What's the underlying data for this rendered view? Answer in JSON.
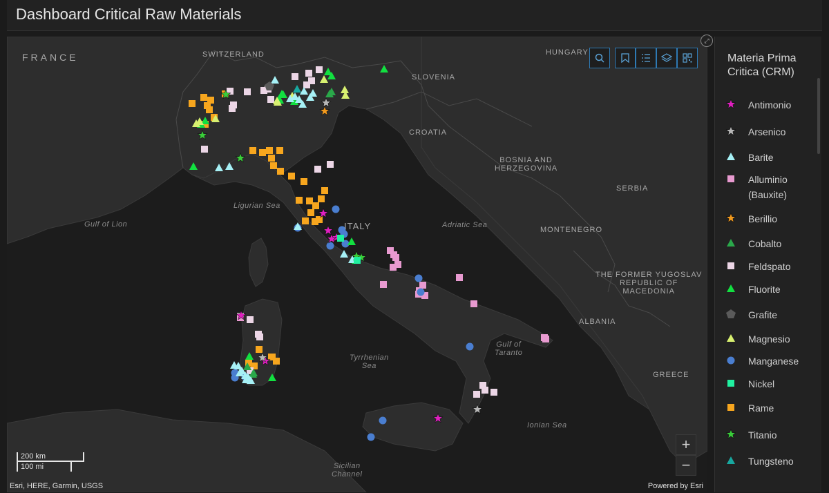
{
  "header": {
    "title": "Dashboard Critical Raw Materials"
  },
  "map": {
    "labels": {
      "france": "FRANCE",
      "switzerland": "SWITZERLAND",
      "hungary": "HUNGARY",
      "slovenia": "SLOVENIA",
      "croatia": "CROATIA",
      "bosnia": "BOSNIA AND\nHERZEGOVINA",
      "serbia": "SERBIA",
      "montenegro": "MONTENEGRO",
      "fyrom": "THE FORMER YUGOSLAV\nREPUBLIC OF\nMACEDONIA",
      "albania": "ALBANIA",
      "greece": "GREECE",
      "italy": "ITALY",
      "ligurian": "Ligurian Sea",
      "lion": "Gulf of Lion",
      "adriatic": "Adriatic Sea",
      "taranto": "Gulf of\nTaranto",
      "tyrrhenian": "Tyrrhenian\nSea",
      "ionian": "Ionian Sea",
      "sicilian": "Sicilian\nChannel"
    },
    "scalebar": {
      "km": "200 km",
      "mi": "100 mi"
    },
    "attribution": "Esri, HERE, Garmin, USGS",
    "powered": "Powered by Esri",
    "tools": [
      "search-icon",
      "bookmark-icon",
      "layer-list-icon",
      "layers-icon",
      "qr-code-icon"
    ],
    "zoom": {
      "in": "+",
      "out": "−"
    }
  },
  "legend": {
    "title": "Materia Prima Critica (CRM)",
    "items": [
      {
        "label": "Antimonio",
        "shape": "star",
        "color": "#e020c0"
      },
      {
        "label": "Arsenico",
        "shape": "star",
        "color": "#b8b8b8"
      },
      {
        "label": "Barite",
        "shape": "triangle",
        "color": "#a6f0f5"
      },
      {
        "label": "Alluminio (Bauxite)",
        "shape": "square",
        "color": "#e89ad0"
      },
      {
        "label": "Berillio",
        "shape": "star",
        "color": "#f29a1e"
      },
      {
        "label": "Cobalto",
        "shape": "triangle",
        "color": "#2aa84a"
      },
      {
        "label": "Feldspato",
        "shape": "square",
        "color": "#ecd6e6"
      },
      {
        "label": "Fluorite",
        "shape": "triangle",
        "color": "#12e040"
      },
      {
        "label": "Grafite",
        "shape": "pentagon",
        "color": "#5a5a5a"
      },
      {
        "label": "Magnesio",
        "shape": "triangle",
        "color": "#d8f070"
      },
      {
        "label": "Manganese",
        "shape": "circle",
        "color": "#4a7ed0"
      },
      {
        "label": "Nickel",
        "shape": "square",
        "color": "#20f0a0"
      },
      {
        "label": "Rame",
        "shape": "square",
        "color": "#f7a61e"
      },
      {
        "label": "Titanio",
        "shape": "star",
        "color": "#3acd3a"
      },
      {
        "label": "Tungsteno",
        "shape": "triangle",
        "color": "#18a8a0"
      }
    ]
  }
}
